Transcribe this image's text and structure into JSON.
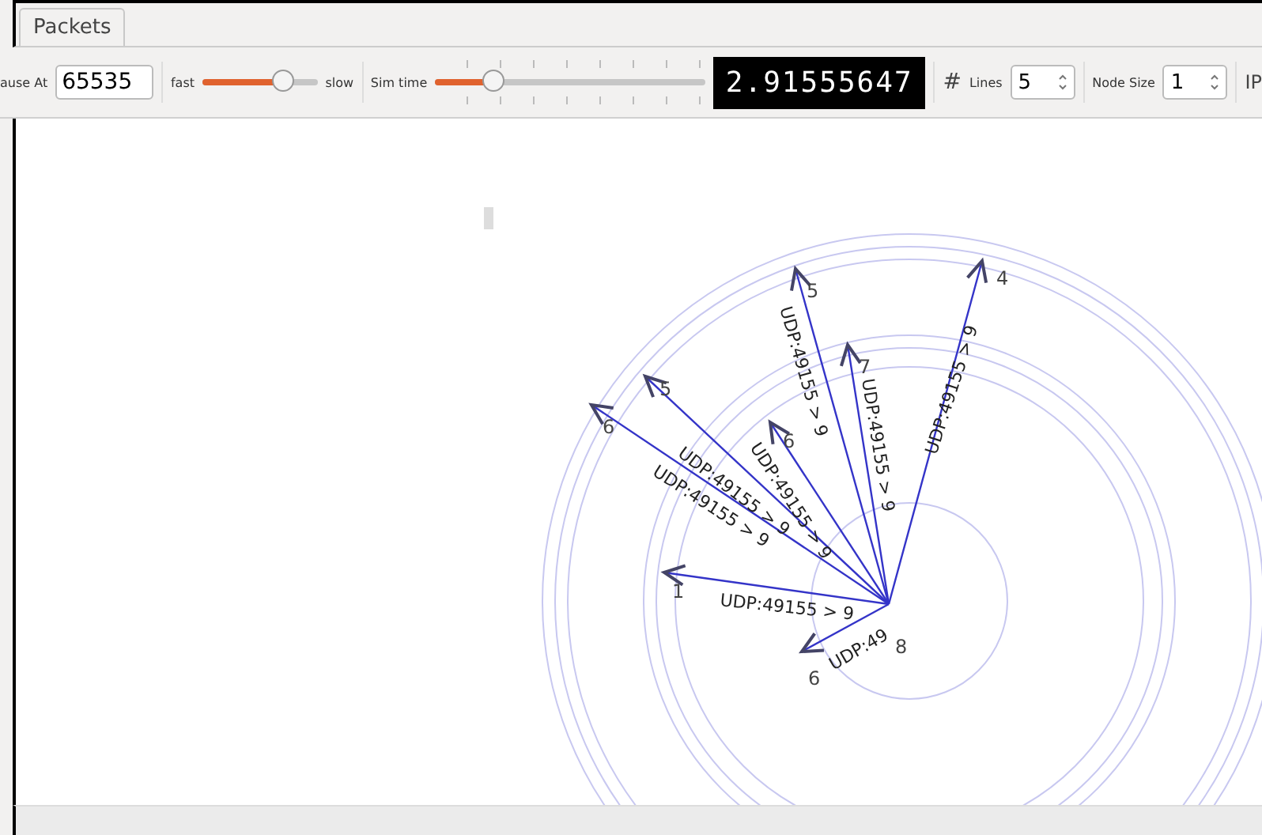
{
  "tabs": [
    {
      "label": "Packets",
      "selected": true
    }
  ],
  "toolbar": {
    "pause_label": "ause At",
    "pause_value": "65535",
    "speed_fast": "fast",
    "speed_slow": "slow",
    "speed_slider": {
      "level": 0.72
    },
    "sim_time_label": "Sim time",
    "sim_time_slider": {
      "level": 0.22
    },
    "time_display": "2.91555647",
    "grid_icon": "#",
    "lines_label": "Lines",
    "lines_value": "5",
    "node_size_label": "Node Size",
    "node_size_value": "1",
    "ip_label": "IP"
  },
  "canvas": {
    "nodes": [
      {
        "label": "6"
      },
      {
        "label": "5"
      },
      {
        "label": "5"
      },
      {
        "label": "4"
      },
      {
        "label": "7"
      },
      {
        "label": "6"
      },
      {
        "label": "1"
      },
      {
        "label": "6"
      },
      {
        "label": "8"
      }
    ],
    "packets": [
      {
        "label": "UDP:49155 > 9"
      },
      {
        "label": "UDP:49155 > 9"
      },
      {
        "label": "UDP:49155 > 9"
      },
      {
        "label": "UDP:49155 > 9"
      },
      {
        "label": "UDP:49155 > 9"
      },
      {
        "label": "UDP:49155 > 9"
      },
      {
        "label": "UDP:49155 > 9"
      },
      {
        "label": "UDP:49"
      }
    ]
  }
}
